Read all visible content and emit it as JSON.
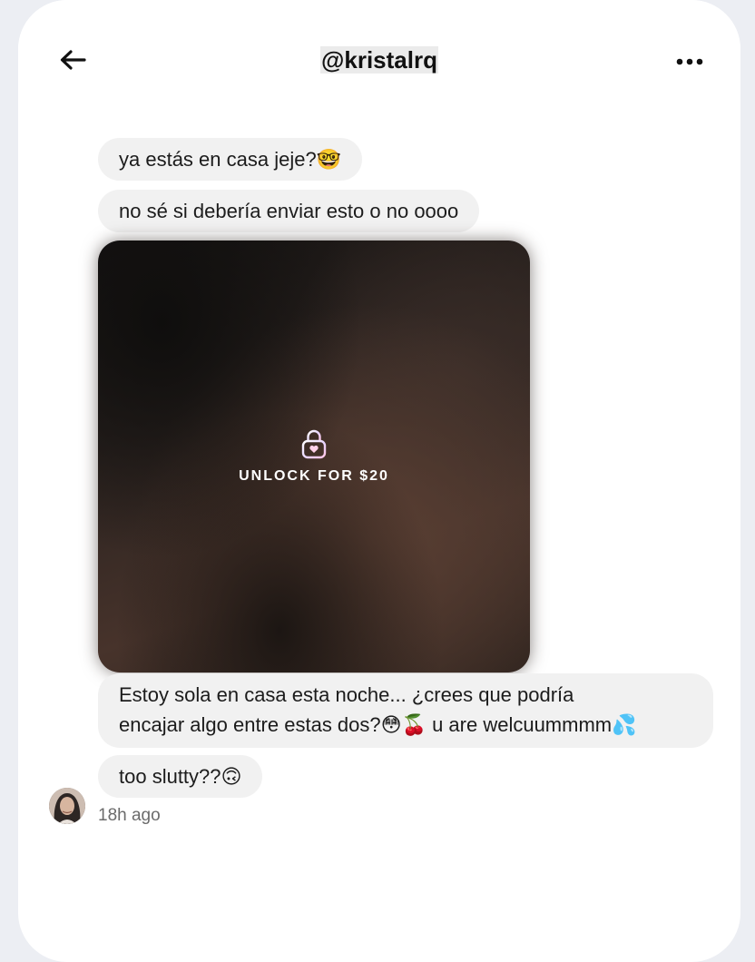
{
  "header": {
    "title": "@kristalrq",
    "back_icon": "arrow-left-icon",
    "more_icon": "more-horizontal-icon"
  },
  "messages": [
    {
      "text": "ya estás en casa jeje?🤓"
    },
    {
      "text": "no sé si debería enviar esto o no oooo"
    },
    {
      "text": "Estoy sola en casa esta noche... ¿crees que podría",
      "text2": "encajar algo entre estas dos?😳🍒 u are welcuummmm💦"
    },
    {
      "text": "too slutty??🙃"
    }
  ],
  "media": {
    "unlock_label": "UNLOCK FOR $20",
    "icon": "lock-heart-icon"
  },
  "footer": {
    "timestamp": "18h ago"
  }
}
